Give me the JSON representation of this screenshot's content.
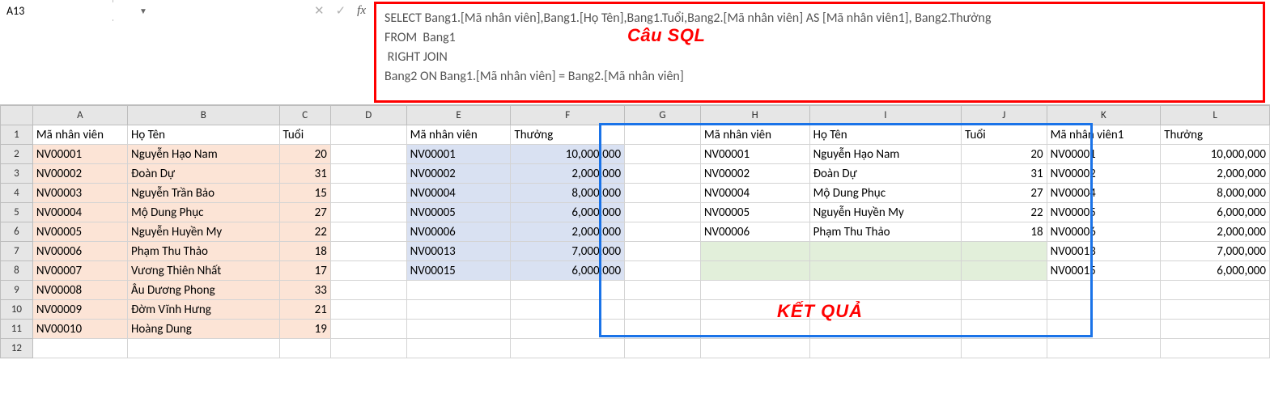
{
  "namebox": {
    "value": "A13"
  },
  "formula": {
    "lines": [
      "SELECT Bang1.[Mã nhân viên],Bang1.[Họ Tên],Bang1.Tuổi,Bang2.[Mã nhân viên] AS [Mã nhân viên1], Bang2.Thưởng",
      "FROM  Bang1",
      " RIGHT JOIN",
      "Bang2 ON Bang1.[Mã nhân viên] = Bang2.[Mã nhân viên]"
    ],
    "label": "Câu SQL"
  },
  "result_label": "KẾT QUẢ",
  "columns": [
    "A",
    "B",
    "C",
    "D",
    "E",
    "F",
    "G",
    "H",
    "I",
    "J",
    "K",
    "L"
  ],
  "headers": {
    "A": "Mã nhân viên",
    "B": "Họ Tên",
    "C": "Tuổi",
    "E": "Mã nhân viên",
    "F": "Thưởng",
    "H": "Mã nhân viên",
    "I": "Họ Tên",
    "J": "Tuổi",
    "K": "Mã nhân viên1",
    "L": "Thưởng"
  },
  "bang1": [
    {
      "ma": "NV00001",
      "ten": "Nguyễn Hạo Nam",
      "tuoi": "20"
    },
    {
      "ma": "NV00002",
      "ten": "Đoàn Dự",
      "tuoi": "31"
    },
    {
      "ma": "NV00003",
      "ten": "Nguyễn Trần Bảo",
      "tuoi": "15"
    },
    {
      "ma": "NV00004",
      "ten": "Mộ Dung Phục",
      "tuoi": "27"
    },
    {
      "ma": "NV00005",
      "ten": "Nguyễn Huyền My",
      "tuoi": "22"
    },
    {
      "ma": "NV00006",
      "ten": "Phạm Thu Thảo",
      "tuoi": "18"
    },
    {
      "ma": "NV00007",
      "ten": "Vương Thiên Nhất",
      "tuoi": "17"
    },
    {
      "ma": "NV00008",
      "ten": "Âu Dương Phong",
      "tuoi": "33"
    },
    {
      "ma": "NV00009",
      "ten": "Đờm Vĩnh Hưng",
      "tuoi": "21"
    },
    {
      "ma": "NV00010",
      "ten": "Hoàng Dung",
      "tuoi": "19"
    }
  ],
  "bang2": [
    {
      "ma": "NV00001",
      "thuong": "10,000,000"
    },
    {
      "ma": "NV00002",
      "thuong": "2,000,000"
    },
    {
      "ma": "NV00004",
      "thuong": "8,000,000"
    },
    {
      "ma": "NV00005",
      "thuong": "6,000,000"
    },
    {
      "ma": "NV00006",
      "thuong": "2,000,000"
    },
    {
      "ma": "NV00013",
      "thuong": "7,000,000"
    },
    {
      "ma": "NV00015",
      "thuong": "6,000,000"
    }
  ],
  "result": [
    {
      "ma": "NV00001",
      "ten": "Nguyễn Hạo Nam",
      "tuoi": "20",
      "ma1": "NV00001",
      "thuong": "10,000,000"
    },
    {
      "ma": "NV00002",
      "ten": "Đoàn Dự",
      "tuoi": "31",
      "ma1": "NV00002",
      "thuong": "2,000,000"
    },
    {
      "ma": "NV00004",
      "ten": "Mộ Dung Phục",
      "tuoi": "27",
      "ma1": "NV00004",
      "thuong": "8,000,000"
    },
    {
      "ma": "NV00005",
      "ten": "Nguyễn Huyền My",
      "tuoi": "22",
      "ma1": "NV00005",
      "thuong": "6,000,000"
    },
    {
      "ma": "NV00006",
      "ten": "Phạm Thu Thảo",
      "tuoi": "18",
      "ma1": "NV00006",
      "thuong": "2,000,000"
    },
    {
      "ma": "",
      "ten": "",
      "tuoi": "",
      "ma1": "NV00013",
      "thuong": "7,000,000"
    },
    {
      "ma": "",
      "ten": "",
      "tuoi": "",
      "ma1": "NV00015",
      "thuong": "6,000,000"
    }
  ]
}
